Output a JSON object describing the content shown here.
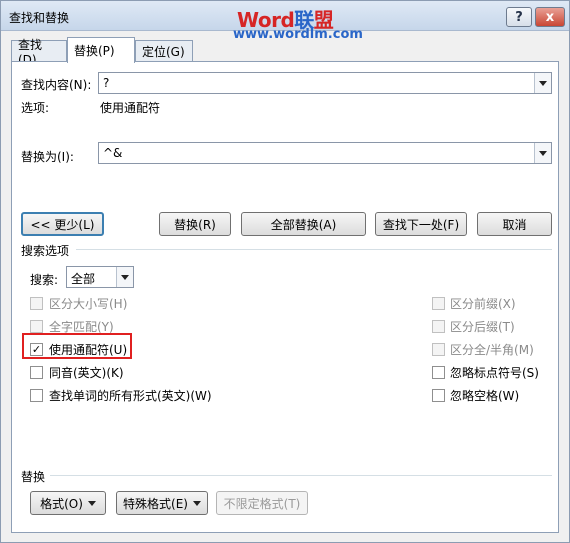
{
  "window": {
    "title": "查找和替换",
    "help_label": "?",
    "close_label": "x",
    "watermark": {
      "brand_a": "Word",
      "brand_b": "联",
      "brand_c": "盟",
      "url": "www.wordlm.com"
    }
  },
  "tabs": [
    {
      "label": "查找(D)",
      "active": false
    },
    {
      "label": "替换(P)",
      "active": true
    },
    {
      "label": "定位(G)",
      "active": false
    }
  ],
  "find": {
    "label": "查找内容(N):",
    "value": "?",
    "options_label": "选项:",
    "options_value": "使用通配符"
  },
  "replace": {
    "label": "替换为(I):",
    "value": "^&"
  },
  "buttons": {
    "less": "<< 更少(L)",
    "replace": "替换(R)",
    "replace_all": "全部替换(A)",
    "find_next": "查找下一处(F)",
    "cancel": "取消"
  },
  "search_options": {
    "heading": "搜索选项",
    "search_label": "搜索:",
    "search_value": "全部",
    "left": [
      {
        "label": "区分大小写(H)",
        "checked": false,
        "enabled": false
      },
      {
        "label": "全字匹配(Y)",
        "checked": false,
        "enabled": false
      },
      {
        "label": "使用通配符(U)",
        "checked": true,
        "enabled": true
      },
      {
        "label": "同音(英文)(K)",
        "checked": false,
        "enabled": true
      },
      {
        "label": "查找单词的所有形式(英文)(W)",
        "checked": false,
        "enabled": true
      }
    ],
    "right": [
      {
        "label": "区分前缀(X)",
        "checked": false,
        "enabled": false
      },
      {
        "label": "区分后缀(T)",
        "checked": false,
        "enabled": false
      },
      {
        "label": "区分全/半角(M)",
        "checked": false,
        "enabled": false
      },
      {
        "label": "忽略标点符号(S)",
        "checked": false,
        "enabled": true
      },
      {
        "label": "忽略空格(W)",
        "checked": false,
        "enabled": true
      }
    ]
  },
  "replace_section": {
    "heading": "替换",
    "format": "格式(O)",
    "special": "特殊格式(E)",
    "no_format": "不限定格式(T)"
  }
}
